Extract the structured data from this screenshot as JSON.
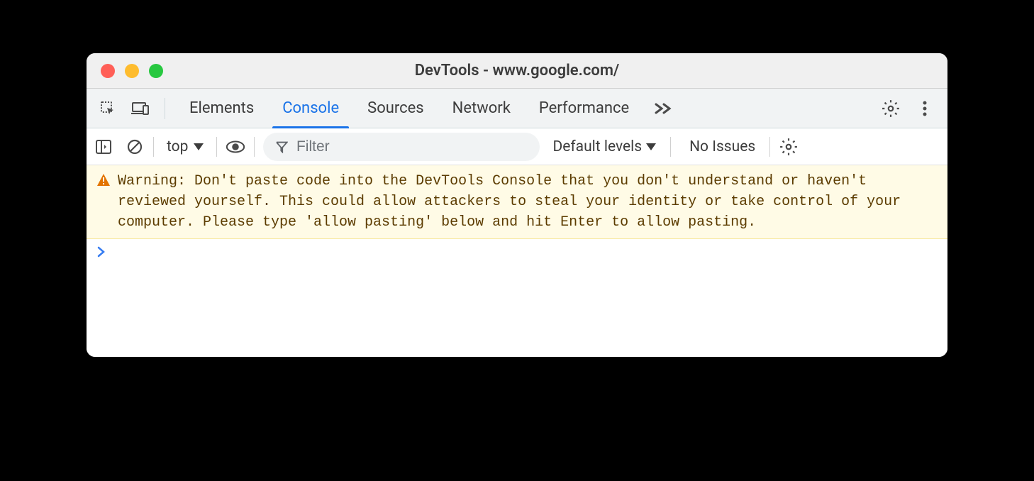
{
  "window": {
    "title": "DevTools - www.google.com/"
  },
  "tabs": {
    "elements": "Elements",
    "console": "Console",
    "sources": "Sources",
    "network": "Network",
    "performance": "Performance"
  },
  "toolbar": {
    "context": "top",
    "filter_placeholder": "Filter",
    "levels": "Default levels",
    "issues": "No Issues"
  },
  "console": {
    "warning": "Warning: Don't paste code into the DevTools Console that you don't understand or haven't reviewed yourself. This could allow attackers to steal your identity or take control of your computer. Please type 'allow pasting' below and hit Enter to allow pasting."
  }
}
